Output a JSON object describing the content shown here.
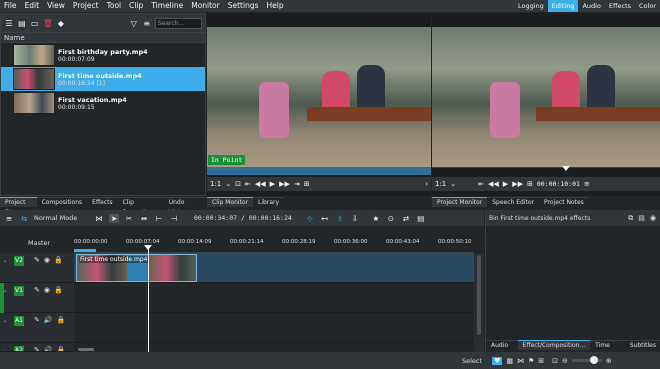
{
  "menu": [
    "File",
    "Edit",
    "View",
    "Project",
    "Tool",
    "Clip",
    "Timeline",
    "Monitor",
    "Settings",
    "Help"
  ],
  "layouts": [
    "Logging",
    "Editing",
    "Audio",
    "Effects",
    "Color"
  ],
  "active_layout": "Editing",
  "bin": {
    "search_placeholder": "Search...",
    "header": "Name",
    "clips": [
      {
        "name": "First birthday party.mp4",
        "duration": "00:00:07:09"
      },
      {
        "name": "First time outside.mp4",
        "duration": "00:00:16:24 [1]"
      },
      {
        "name": "First vacation.mp4",
        "duration": "00:00:09:15"
      }
    ]
  },
  "bin_tabs": [
    "Project Bin",
    "Compositions",
    "Effects",
    "Clip Properties",
    "Undo History"
  ],
  "clip_monitor": {
    "label": "In Point",
    "zoom": "1:1",
    "tabs": [
      "Clip Monitor",
      "Library"
    ]
  },
  "project_monitor": {
    "zoom": "1:1",
    "timecode": "00:00:10:01",
    "tabs": [
      "Project Monitor",
      "Speech Editor",
      "Project Notes"
    ]
  },
  "timeline": {
    "mode": "Normal Mode",
    "position": "00:00:34:07 / 00:00:16:24",
    "master": "Master",
    "ruler": [
      "00:00:00:00",
      "00:00:07:04",
      "00:00:14:09",
      "00:00:21:14",
      "00:00:28:19",
      "00:00:36:00",
      "00:00:43:04",
      "00:00:50:10"
    ],
    "clip_label": "First time outside.mp4",
    "tracks": [
      "V2",
      "V1",
      "A1",
      "A2"
    ]
  },
  "effects_panel": {
    "title": "Bin First time outside.mp4 effects",
    "tabs": [
      "Audio Mi...",
      "Effect/Composition...",
      "Time Rem...",
      "Subtitles"
    ]
  },
  "status": {
    "select": "Select"
  }
}
